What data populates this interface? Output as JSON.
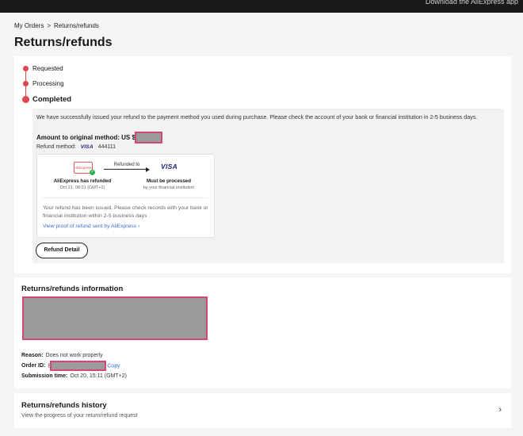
{
  "topbar": {
    "text": "Download the AliExpress app"
  },
  "breadcrumb": {
    "parent": "My Orders",
    "separator": ">",
    "current": "Returns/refunds"
  },
  "page": {
    "title": "Returns/refunds"
  },
  "status": {
    "steps": [
      {
        "label": "Requested"
      },
      {
        "label": "Processing"
      },
      {
        "label": "Completed"
      }
    ],
    "message": "We have successfully issued your refund to the payment method you used during purchase. Please check the account of your bank or financial institution in 2-5 business days.",
    "amount_label": "Amount to original method:",
    "amount_prefix": "US $",
    "refund_method_label": "Refund method:",
    "refund_method_brand": "VISA",
    "refund_method_card": "444111",
    "flow": {
      "source_logo": "AliExpress",
      "arrow_label": "Refunded to",
      "dest_logo": "VISA",
      "left_title": "AliExpress has refunded",
      "left_sub": "Oct 21, 08:01 (GMT+2)",
      "right_title": "Must be processed",
      "right_sub": "by your financial institution",
      "message": "Your refund has been issued. Please check records with your bank or financial institution within 2-5 business days .",
      "proof_link": "View proof of refund sent by AliExpress ›"
    },
    "detail_button": "Refund Detail"
  },
  "info": {
    "title": "Returns/refunds information",
    "reason_label": "Reason:",
    "reason_value": "Does not work properly",
    "order_label": "Order ID:",
    "order_prefix": "8",
    "copy_label": "Copy",
    "submission_label": "Submission time:",
    "submission_value": "Oct 20, 15:11 (GMT+2)"
  },
  "history": {
    "title": "Returns/refunds history",
    "subtitle": "View the progress of your return/refund request",
    "chevron_icon": "chevron-right-icon"
  },
  "colors": {
    "accent": "#e0474e",
    "link": "#3a6fd8",
    "redaction": "#9b9b9b",
    "redaction_border": "#d6457a"
  }
}
